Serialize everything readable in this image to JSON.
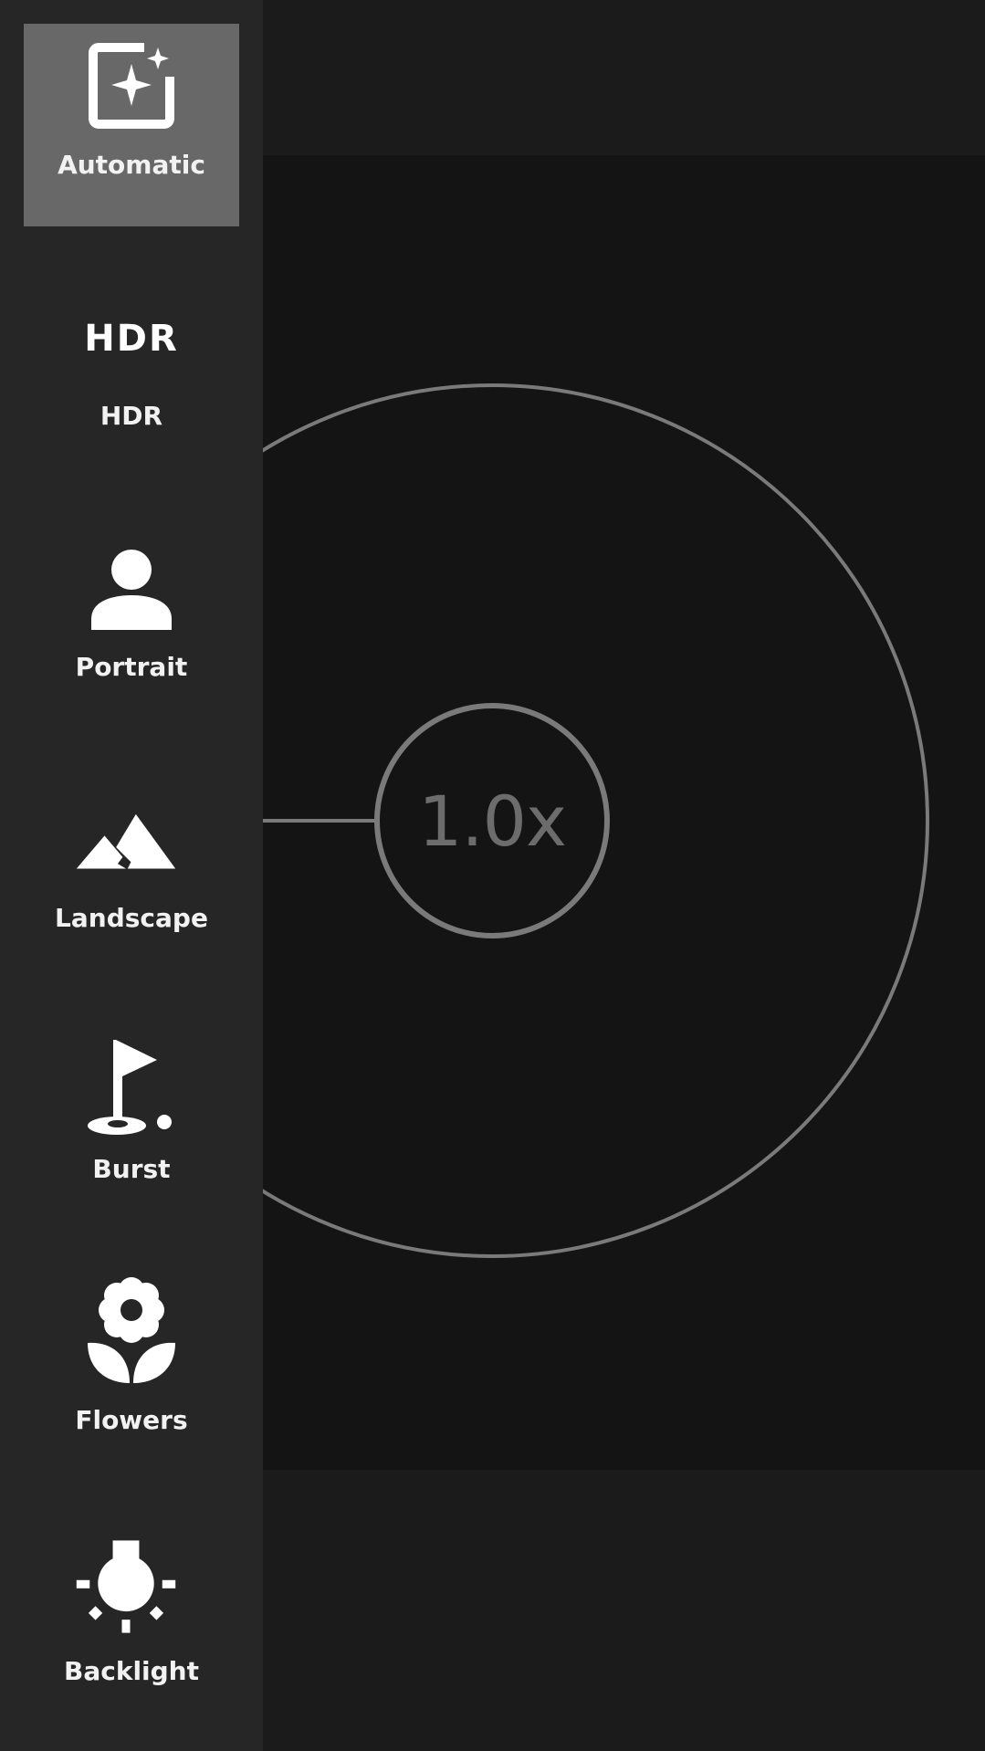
{
  "zoom": {
    "level_label": "1.0x"
  },
  "modes": [
    {
      "label": "Automatic",
      "icon": "auto-sparkle-icon",
      "selected": true
    },
    {
      "label": "HDR",
      "icon": "hdr-icon",
      "icon_text": "HDR",
      "selected": false
    },
    {
      "label": "Portrait",
      "icon": "person-icon",
      "selected": false
    },
    {
      "label": "Landscape",
      "icon": "mountains-icon",
      "selected": false
    },
    {
      "label": "Burst",
      "icon": "golf-flag-icon",
      "selected": false
    },
    {
      "label": "Flowers",
      "icon": "flower-icon",
      "selected": false
    },
    {
      "label": "Backlight",
      "icon": "backlight-bulb-icon",
      "selected": false
    }
  ],
  "colors": {
    "sidebar_bg": "#262626",
    "selected_bg": "#686868",
    "viewfinder_bg": "#141414",
    "dial_stroke": "#7a7a7a",
    "icon_fill": "#ffffff"
  }
}
